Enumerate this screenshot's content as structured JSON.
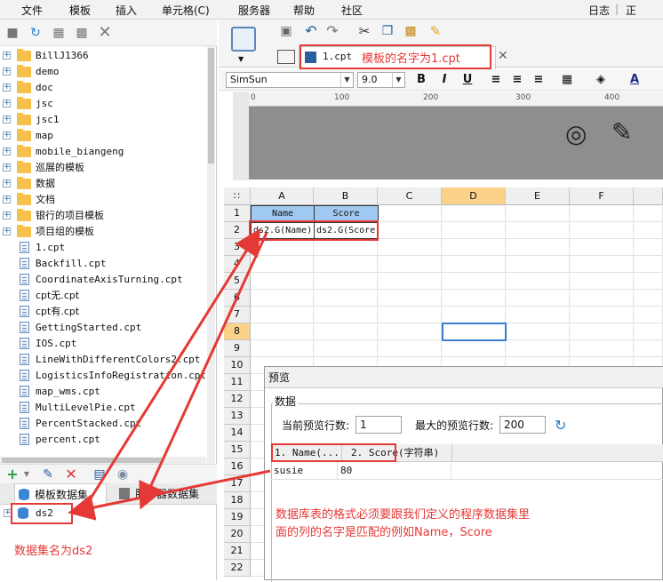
{
  "menu": {
    "items": [
      "文件",
      "模板",
      "插入",
      "单元格(C)",
      "服务器",
      "帮助",
      "社区"
    ],
    "right_log": "日志",
    "right_status": "正常:SE"
  },
  "tree": {
    "items": [
      {
        "type": "folder",
        "label": "BillJ1366"
      },
      {
        "type": "folder",
        "label": "demo"
      },
      {
        "type": "folder",
        "label": "doc"
      },
      {
        "type": "folder",
        "label": "jsc"
      },
      {
        "type": "folder",
        "label": "jsc1"
      },
      {
        "type": "folder",
        "label": "map"
      },
      {
        "type": "folder",
        "label": "mobile_biangeng"
      },
      {
        "type": "folder",
        "label": "巡展的模板"
      },
      {
        "type": "folder",
        "label": "数据"
      },
      {
        "type": "folder",
        "label": "文档"
      },
      {
        "type": "folder",
        "label": "银行的项目模板"
      },
      {
        "type": "folder",
        "label": "项目组的模板"
      },
      {
        "type": "file",
        "label": "1.cpt"
      },
      {
        "type": "file",
        "label": "Backfill.cpt"
      },
      {
        "type": "file",
        "label": "CoordinateAxisTurning.cpt"
      },
      {
        "type": "file",
        "label": "cpt无.cpt"
      },
      {
        "type": "file",
        "label": "cpt有.cpt"
      },
      {
        "type": "file",
        "label": "GettingStarted.cpt"
      },
      {
        "type": "file",
        "label": "IOS.cpt"
      },
      {
        "type": "file",
        "label": "LineWithDifferentColors2.cpt"
      },
      {
        "type": "file",
        "label": "LogisticsInfoRegistration.cpt"
      },
      {
        "type": "file",
        "label": "map_wms.cpt"
      },
      {
        "type": "file",
        "label": "MultiLevelPie.cpt"
      },
      {
        "type": "file",
        "label": "PercentStacked.cpt"
      },
      {
        "type": "file",
        "label": "percent.cpt"
      }
    ]
  },
  "dataset_panel": {
    "tab_template": "模板数据集",
    "tab_server": "服务器数据集",
    "dataset_name": "ds2"
  },
  "annotations": {
    "template_name": "模板的名字为1.cpt",
    "dataset_name": "数据集名为ds2",
    "explain_line1": "数据库表的格式必须要跟我们定义的程序数据集里",
    "explain_line2": "面的列的名字是匹配的例如Name，Score"
  },
  "editor": {
    "file_tab": "1.cpt",
    "font": "SimSun",
    "font_size": "9.0",
    "ruler_ticks": [
      "0",
      "100",
      "200",
      "300",
      "400"
    ],
    "columns": [
      "A",
      "B",
      "C",
      "D",
      "E",
      "F"
    ],
    "rows": [
      "1",
      "2",
      "3",
      "4",
      "5",
      "6",
      "7",
      "8",
      "9",
      "10",
      "11",
      "12",
      "13",
      "14",
      "15",
      "16",
      "17",
      "18",
      "19",
      "20",
      "21",
      "22"
    ],
    "cell_A1": "Name",
    "cell_B1": "Score",
    "cell_A2": "ds2.G(Name)",
    "cell_B2": "ds2.G(Score"
  },
  "preview": {
    "title": "预览",
    "group": "数据",
    "current_rows_label": "当前预览行数:",
    "current_rows": "1",
    "max_rows_label": "最大的预览行数:",
    "max_rows": "200",
    "col1": "1. Name(...",
    "col2": "2. Score(字符串)",
    "row": [
      "susie",
      "80"
    ]
  },
  "colors": {
    "annotation_red": "#e53935",
    "header_blue": "#9fc9f0",
    "selected_header": "#fbd28a"
  }
}
